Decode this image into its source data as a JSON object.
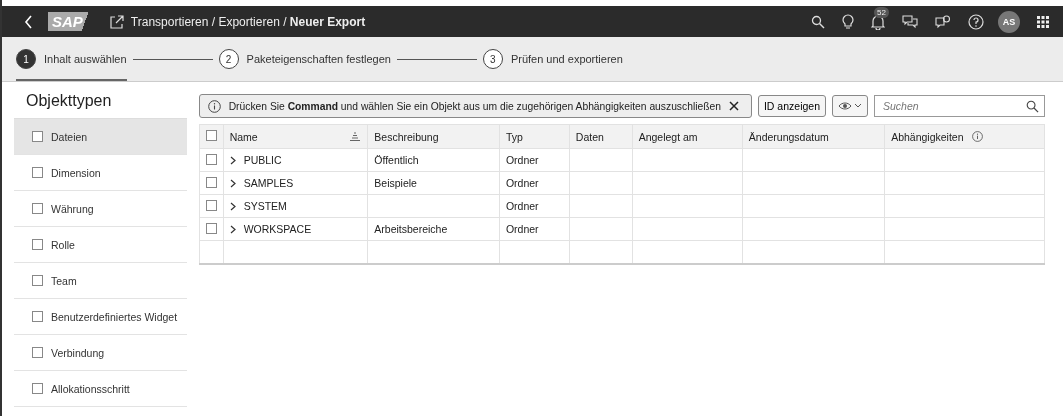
{
  "shell": {
    "logo": "SAP",
    "breadcrumb": "Transportieren / Exportieren / **Neuer Export**",
    "notification_count": "52",
    "avatar": "AS"
  },
  "steps": [
    {
      "number": "1",
      "label": "Inhalt auswählen",
      "selected": true
    },
    {
      "number": "2",
      "label": "Paketeigenschaften festlegen",
      "selected": false
    },
    {
      "number": "3",
      "label": "Prüfen und exportieren",
      "selected": false
    }
  ],
  "sidebar": {
    "title": "Objekttypen",
    "items": [
      {
        "label": "Dateien",
        "selected": true,
        "checked": false
      },
      {
        "label": "Dimension",
        "selected": false,
        "checked": false
      },
      {
        "label": "Währung",
        "selected": false,
        "checked": false
      },
      {
        "label": "Rolle",
        "selected": false,
        "checked": false
      },
      {
        "label": "Team",
        "selected": false,
        "checked": false
      },
      {
        "label": "Benutzerdefiniertes Widget",
        "selected": false,
        "checked": false
      },
      {
        "label": "Verbindung",
        "selected": false,
        "checked": false
      },
      {
        "label": "Allokationsschritt",
        "selected": false,
        "checked": false
      }
    ]
  },
  "message": "Drücken Sie **Command** und wählen Sie ein Objekt aus um die zugehörigen Abhängigkeiten auszuschließen",
  "toolbar": {
    "id_button": "ID anzeigen",
    "search": {
      "placeholder": "Suchen"
    }
  },
  "table": {
    "all_checked": false,
    "columns": [
      "Name",
      "Beschreibung",
      "Typ",
      "Daten",
      "Angelegt am",
      "Änderungsdatum",
      "Abhängigkeiten"
    ],
    "rows": [
      {
        "checked": false,
        "cells": [
          "PUBLIC",
          "Öffentlich",
          "Ordner",
          "",
          "",
          "",
          ""
        ]
      },
      {
        "checked": false,
        "cells": [
          "SAMPLES",
          "Beispiele",
          "Ordner",
          "",
          "",
          "",
          ""
        ]
      },
      {
        "checked": false,
        "cells": [
          "SYSTEM",
          "",
          "Ordner",
          "",
          "",
          "",
          ""
        ]
      },
      {
        "checked": false,
        "cells": [
          "WORKSPACE",
          "Arbeitsbereiche",
          "Ordner",
          "",
          "",
          "",
          ""
        ]
      }
    ]
  }
}
